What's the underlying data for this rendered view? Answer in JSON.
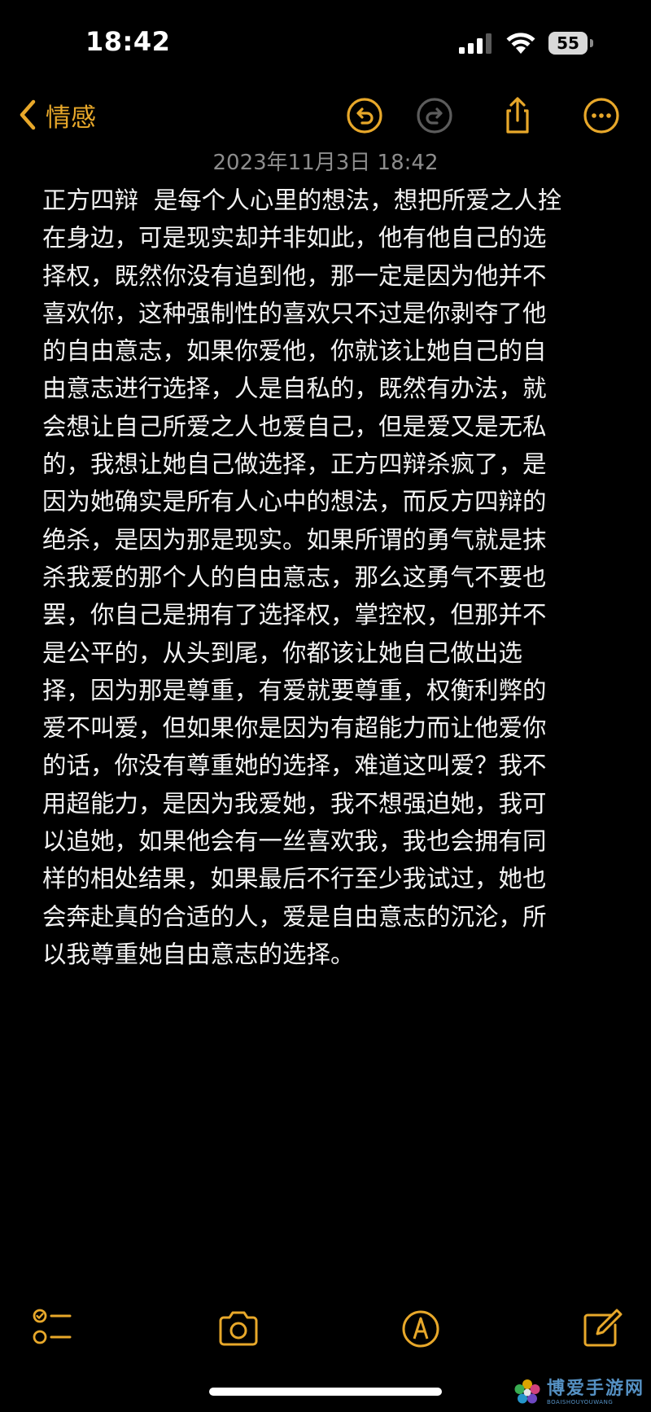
{
  "status_bar": {
    "time": "18:42",
    "battery_level": "55",
    "icons": [
      "signal-icon",
      "wifi-icon",
      "battery-icon"
    ]
  },
  "nav": {
    "back_label": "情感",
    "actions": [
      "undo-icon",
      "redo-icon",
      "share-icon",
      "more-icon"
    ],
    "accent_color": "#e8a82a"
  },
  "note": {
    "date": "2023年11月3日 18:42",
    "lines": [
      "正方四辩  是每个人心里的想法，想把所爱之人拴",
      "在身边，可是现实却并非如此，他有他自己的选",
      "择权，既然你没有追到他，那一定是因为他并不",
      "喜欢你，这种强制性的喜欢只不过是你剥夺了他",
      "的自由意志，如果你爱他，你就该让她自己的自",
      "由意志进行选择，人是自私的，既然有办法，就",
      "会想让自己所爱之人也爱自己，但是爱又是无私",
      "的，我想让她自己做选择，正方四辩杀疯了，是",
      "因为她确实是所有人心中的想法，而反方四辩的",
      "绝杀，是因为那是现实。如果所谓的勇气就是抹",
      "杀我爱的那个人的自由意志，那么这勇气不要也",
      "罢，你自己是拥有了选择权，掌控权，但那并不",
      "是公平的，从头到尾，你都该让她自己做出选",
      "择，因为那是尊重，有爱就要尊重，权衡利弊的",
      "爱不叫爱，但如果你是因为有超能力而让他爱你",
      "的话，你没有尊重她的选择，难道这叫爱？我不",
      "用超能力，是因为我爱她，我不想强迫她，我可",
      "以追她，如果他会有一丝喜欢我，我也会拥有同",
      "样的相处结果，如果最后不行至少我试过，她也",
      "会奔赴真的合适的人，爱是自由意志的沉沦，所",
      "以我尊重她自由意志的选择。"
    ]
  },
  "toolbar": {
    "items": [
      "checklist-icon",
      "camera-icon",
      "markup-pen-icon",
      "compose-icon"
    ]
  },
  "watermark": {
    "title": "博爱手游网",
    "subtitle": "BOAISHOUYOUWANG"
  }
}
